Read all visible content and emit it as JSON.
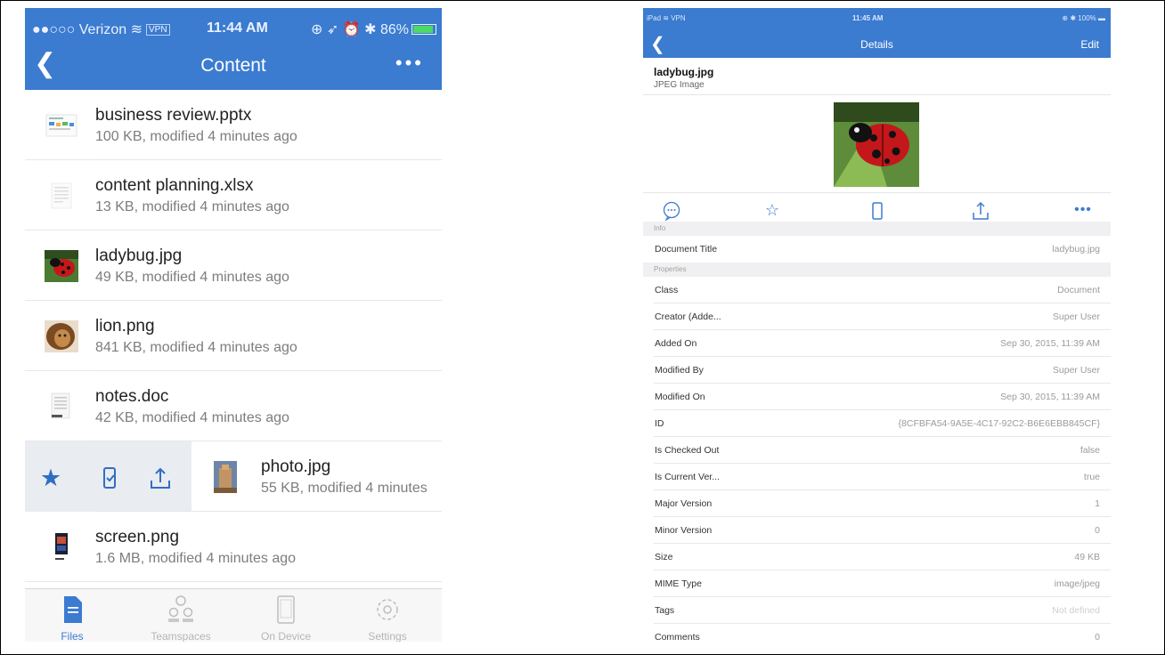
{
  "phone": {
    "status": {
      "carrier": "●●○○○ Verizon",
      "vpn": "VPN",
      "time": "11:44 AM",
      "battery": "86%"
    },
    "nav": {
      "title": "Content",
      "more": "•••"
    },
    "files": [
      {
        "name": "business review.pptx",
        "meta": "100 KB, modified 4 minutes ago",
        "icon": "presentation-icon"
      },
      {
        "name": "content planning.xlsx",
        "meta": "13 KB, modified 4 minutes ago",
        "icon": "spreadsheet-icon"
      },
      {
        "name": "ladybug.jpg",
        "meta": "49 KB, modified 4 minutes ago",
        "icon": "ladybug-thumbnail"
      },
      {
        "name": "lion.png",
        "meta": "841 KB, modified 4 minutes ago",
        "icon": "lion-thumbnail"
      },
      {
        "name": "notes.doc",
        "meta": "42 KB, modified 4 minutes ago",
        "icon": "document-icon"
      },
      {
        "name": "photo.jpg",
        "meta": "55 KB, modified 4 minutes",
        "icon": "photo-thumbnail"
      },
      {
        "name": "screen.png",
        "meta": "1.6 MB, modified 4 minutes ago",
        "icon": "screen-thumbnail"
      }
    ],
    "tabs": [
      {
        "label": "Files",
        "icon": "files-icon",
        "active": true
      },
      {
        "label": "Teamspaces",
        "icon": "teamspaces-icon",
        "active": false
      },
      {
        "label": "On Device",
        "icon": "device-icon",
        "active": false
      },
      {
        "label": "Settings",
        "icon": "gear-icon",
        "active": false
      }
    ],
    "accent": "#3b7bd0"
  },
  "tablet": {
    "status": {
      "left": "iPad",
      "vpn": "VPN",
      "time": "11:45 AM",
      "battery": "100%"
    },
    "nav": {
      "title": "Details",
      "edit": "Edit"
    },
    "file": {
      "name": "ladybug.jpg",
      "type": "JPEG Image"
    },
    "sections": {
      "info": "Info",
      "properties": "Properties"
    },
    "info": [
      {
        "key": "Document Title",
        "value": "ladybug.jpg"
      }
    ],
    "properties": [
      {
        "key": "Class",
        "value": "Document"
      },
      {
        "key": "Creator (Adde...",
        "value": "Super User"
      },
      {
        "key": "Added On",
        "value": "Sep 30, 2015, 11:39 AM"
      },
      {
        "key": "Modified By",
        "value": "Super User"
      },
      {
        "key": "Modified On",
        "value": "Sep 30, 2015, 11:39 AM"
      },
      {
        "key": "ID",
        "value": "{8CFBFA54-9A5E-4C17-92C2-B6E6EBB845CF}"
      },
      {
        "key": "Is Checked Out",
        "value": "false"
      },
      {
        "key": "Is Current Ver...",
        "value": "true"
      },
      {
        "key": "Major Version",
        "value": "1"
      },
      {
        "key": "Minor Version",
        "value": "0"
      },
      {
        "key": "Size",
        "value": "49 KB"
      },
      {
        "key": "MIME Type",
        "value": "image/jpeg"
      },
      {
        "key": "Tags",
        "value": "Not defined"
      },
      {
        "key": "Comments",
        "value": "0"
      }
    ]
  }
}
